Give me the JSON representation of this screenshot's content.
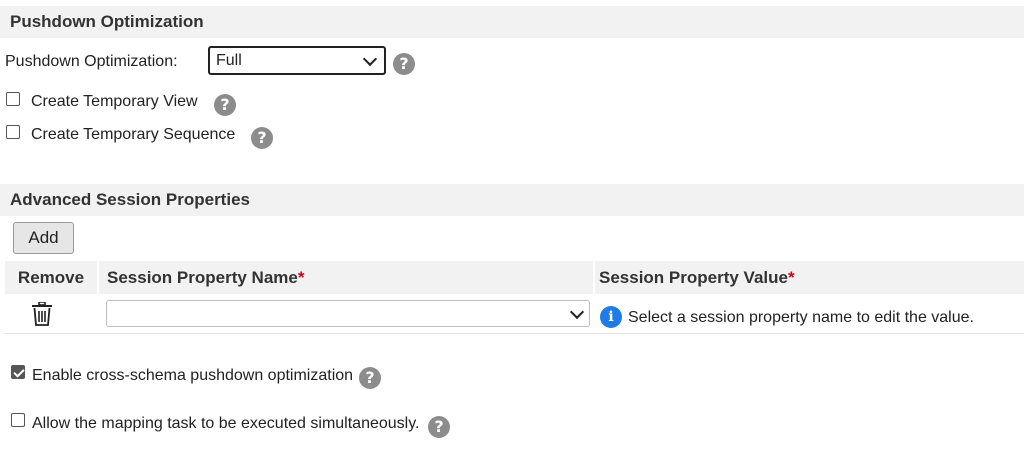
{
  "pushdown_section": {
    "title": "Pushdown Optimization",
    "optimization_label": "Pushdown Optimization:",
    "optimization_value": "Full",
    "create_temp_view_label": "Create Temporary View",
    "create_temp_view_checked": false,
    "create_temp_sequence_label": "Create Temporary Sequence",
    "create_temp_sequence_checked": false
  },
  "advanced_section": {
    "title": "Advanced Session Properties",
    "add_label": "Add",
    "columns": {
      "remove": "Remove",
      "name": "Session Property Name",
      "value": "Session Property Value",
      "required_mark": "*"
    },
    "rows": [
      {
        "name_value": "",
        "value_hint": "Select a session property name to edit the value."
      }
    ]
  },
  "options": {
    "cross_schema_label": "Enable cross-schema pushdown optimization",
    "cross_schema_checked": true,
    "simultaneous_label": "Allow the mapping task to be executed simultaneously.",
    "simultaneous_checked": false
  },
  "icons": {
    "help_glyph": "?",
    "info_glyph": "i"
  },
  "colors": {
    "help_icon": "#8c8c8c",
    "info_icon": "#1f7be6",
    "required": "#d0021b",
    "section_bg": "#f2f2f2"
  }
}
